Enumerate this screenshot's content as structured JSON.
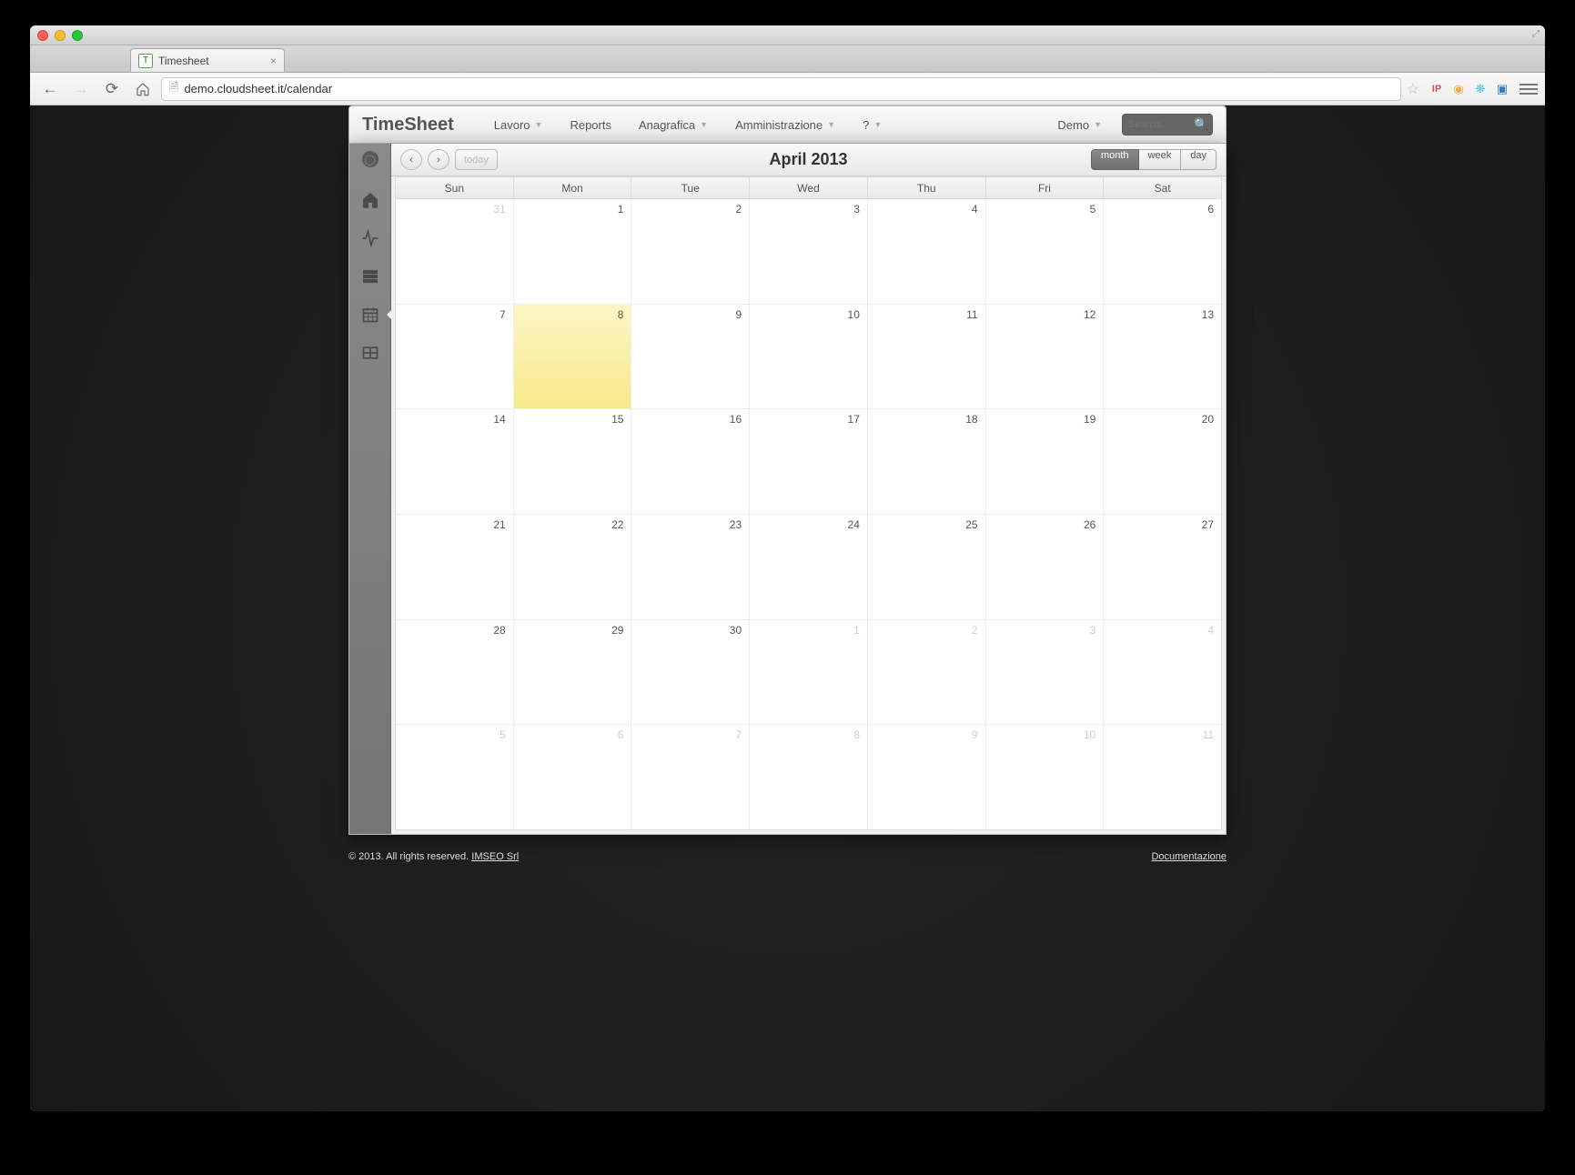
{
  "browser": {
    "tab_title": "Timesheet",
    "url": "demo.cloudsheet.it/calendar",
    "ext_ip_label": "IP"
  },
  "app": {
    "brand": "TimeSheet",
    "menu": [
      "Lavoro",
      "Reports",
      "Anagrafica",
      "Amministrazione",
      "?"
    ],
    "user": "Demo",
    "search_placeholder": "Search..."
  },
  "calendar": {
    "title": "April 2013",
    "today_label": "today",
    "views": {
      "month": "month",
      "week": "week",
      "day": "day"
    },
    "active_view": "month",
    "day_headers": [
      "Sun",
      "Mon",
      "Tue",
      "Wed",
      "Thu",
      "Fri",
      "Sat"
    ],
    "today_key": "8",
    "weeks": [
      [
        {
          "n": "31",
          "other": true
        },
        {
          "n": "1"
        },
        {
          "n": "2"
        },
        {
          "n": "3"
        },
        {
          "n": "4"
        },
        {
          "n": "5"
        },
        {
          "n": "6"
        }
      ],
      [
        {
          "n": "7"
        },
        {
          "n": "8",
          "today": true
        },
        {
          "n": "9"
        },
        {
          "n": "10"
        },
        {
          "n": "11"
        },
        {
          "n": "12"
        },
        {
          "n": "13"
        }
      ],
      [
        {
          "n": "14"
        },
        {
          "n": "15"
        },
        {
          "n": "16"
        },
        {
          "n": "17"
        },
        {
          "n": "18"
        },
        {
          "n": "19"
        },
        {
          "n": "20"
        }
      ],
      [
        {
          "n": "21"
        },
        {
          "n": "22"
        },
        {
          "n": "23"
        },
        {
          "n": "24"
        },
        {
          "n": "25"
        },
        {
          "n": "26"
        },
        {
          "n": "27"
        }
      ],
      [
        {
          "n": "28"
        },
        {
          "n": "29"
        },
        {
          "n": "30"
        },
        {
          "n": "1",
          "other": true
        },
        {
          "n": "2",
          "other": true
        },
        {
          "n": "3",
          "other": true
        },
        {
          "n": "4",
          "other": true
        }
      ],
      [
        {
          "n": "5",
          "other": true
        },
        {
          "n": "6",
          "other": true
        },
        {
          "n": "7",
          "other": true
        },
        {
          "n": "8",
          "other": true
        },
        {
          "n": "9",
          "other": true
        },
        {
          "n": "10",
          "other": true
        },
        {
          "n": "11",
          "other": true
        }
      ]
    ]
  },
  "footer": {
    "copyright": "© 2013. All rights reserved. ",
    "copyright_link": "IMSEO Srl",
    "doc_link": "Documentazione"
  }
}
